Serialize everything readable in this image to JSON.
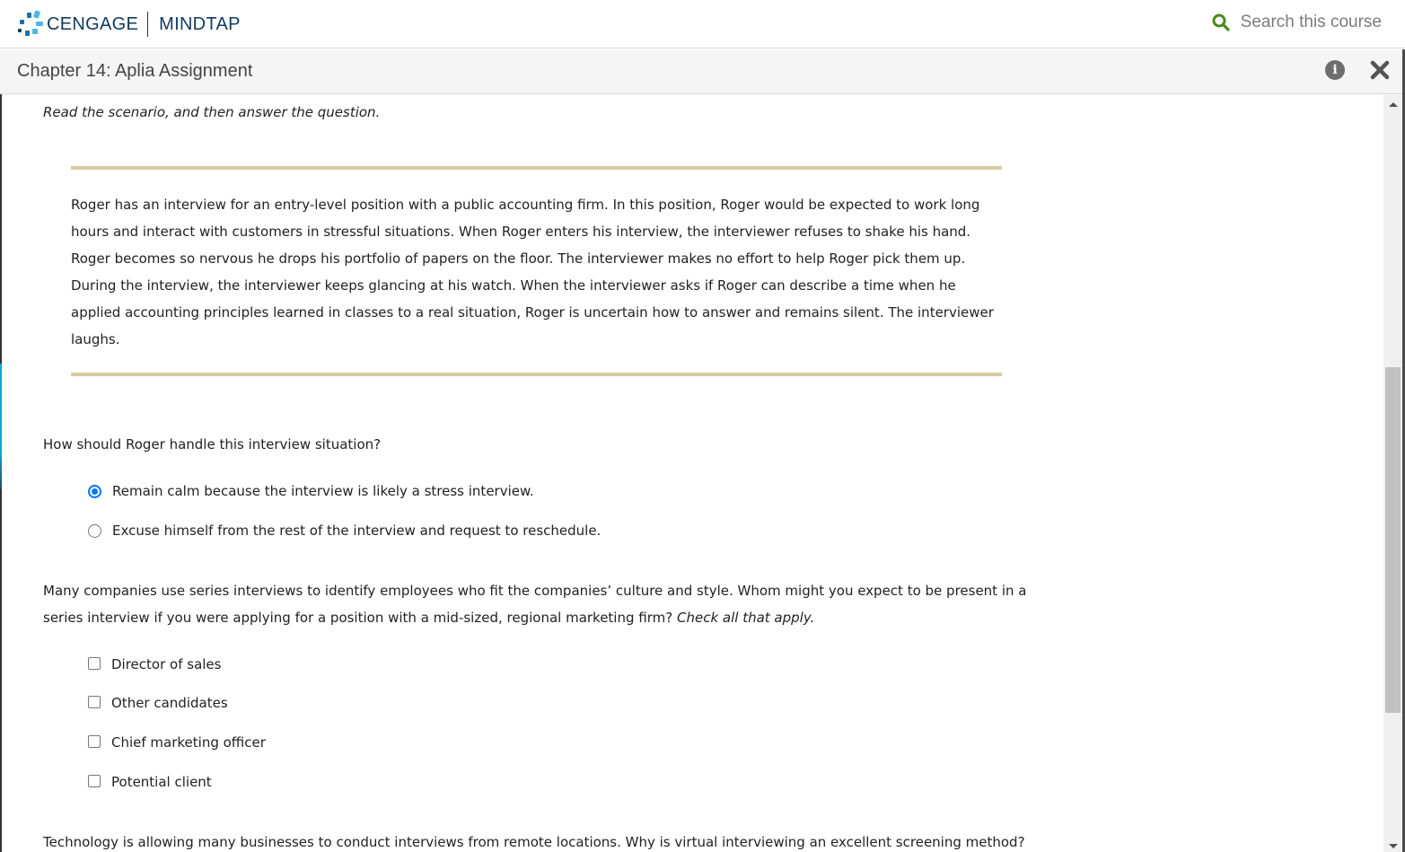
{
  "header": {
    "brand_left": "CENGAGE",
    "brand_right": "MINDTAP",
    "search_placeholder": "Search this course",
    "brand_color": "#0f3a5f",
    "search_icon_color": "#4a8a1c"
  },
  "titlebar": {
    "title": "Chapter 14: Aplia Assignment",
    "info_label": "i"
  },
  "content": {
    "instruction": "Read the scenario, and then answer the question.",
    "scenario": "Roger has an interview for an entry-level position with a public accounting firm. In this position, Roger would be expected to work long hours and interact with customers in stressful situations. When Roger enters his interview, the interviewer refuses to shake his hand. Roger becomes so nervous he drops his portfolio of papers on the floor. The interviewer makes no effort to help Roger pick them up. During the interview, the interviewer keeps glancing at his watch. When the interviewer asks if Roger can describe a time when he applied accounting principles learned in classes to a real situation, Roger is uncertain how to answer and remains silent. The interviewer laughs.",
    "q1": {
      "prompt": "How should Roger handle this interview situation?",
      "options": [
        {
          "label": "Remain calm because the interview is likely a stress interview.",
          "selected": true
        },
        {
          "label": "Excuse himself from the rest of the interview and request to reschedule.",
          "selected": false
        }
      ]
    },
    "q2": {
      "prompt": "Many companies use series interviews to identify employees who fit the companies’ culture and style. Whom might you expect to be present in a series interview if you were applying for a position with a mid-sized, regional marketing firm?",
      "prompt_emphasis": "Check all that apply.",
      "options": [
        {
          "label": "Director of sales",
          "checked": false
        },
        {
          "label": "Other candidates",
          "checked": false
        },
        {
          "label": "Chief marketing officer",
          "checked": false
        },
        {
          "label": "Potential client",
          "checked": false
        }
      ]
    },
    "q3": {
      "prompt": "Technology is allowing many businesses to conduct interviews from remote locations. Why is virtual interviewing an excellent screening method?"
    }
  },
  "colors": {
    "scenario_rule": "#d8cca0",
    "radio_selected": "#0075ff"
  }
}
